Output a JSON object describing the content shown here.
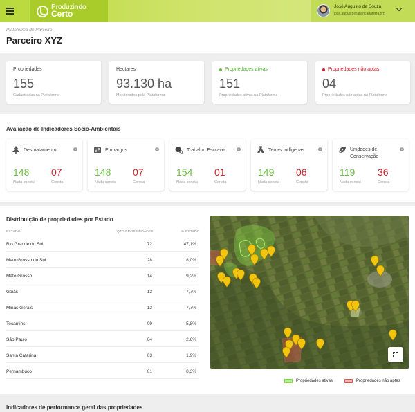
{
  "app": {
    "logo_line1": "Produzindo",
    "logo_line2": "Certo"
  },
  "user": {
    "name": "José Augusto de Souza",
    "email": "jose.augusto@aliancadaterra.org"
  },
  "header": {
    "breadcrumb": "Plataforma do Parceiro",
    "title": "Parceiro XYZ"
  },
  "summary": [
    {
      "label": "Propriedades",
      "value": "155",
      "sub": "Cadastradas na Plataforma",
      "dot": null
    },
    {
      "label": "Hectares",
      "value": "93.130 ha",
      "sub": "Monitorados pela Plataforma",
      "dot": null
    },
    {
      "label": "Propriedades ativas",
      "value": "151",
      "sub": "Propriedades ativas na Plataforma",
      "dot": "#6bbd45"
    },
    {
      "label": "Propriedades não aptas",
      "value": "04",
      "sub": "Propriedades não aptas na Plataforma",
      "dot": "#d0202c"
    }
  ],
  "indicators": {
    "title": "Avaliação de Indicadores Sócio-Ambientais",
    "cards": [
      {
        "label": "Desmatamento",
        "icon": "tree-icon",
        "ok": "148",
        "ok_label": "Nada consta",
        "bad": "07",
        "bad_label": "Consta"
      },
      {
        "label": "Embargos",
        "icon": "embargo-icon",
        "ok": "148",
        "ok_label": "Nada consta",
        "bad": "07",
        "bad_label": "Consta"
      },
      {
        "label": "Trabalho Escravo",
        "icon": "chain-icon",
        "ok": "154",
        "ok_label": "Nada consta",
        "bad": "01",
        "bad_label": "Consta"
      },
      {
        "label": "Terras Indígenas",
        "icon": "tent-icon",
        "ok": "149",
        "ok_label": "Nada consta",
        "bad": "06",
        "bad_label": "Consta"
      },
      {
        "label": "Unidades de Conservação",
        "icon": "leaf-icon",
        "ok": "119",
        "ok_label": "Nada consta",
        "bad": "36",
        "bad_label": "Consta"
      }
    ]
  },
  "distribution": {
    "title": "Distribuição de propriedades por Estado",
    "headers": [
      "ESTADO",
      "QTD PROPRIEDADES",
      "% ESTADO"
    ],
    "rows": [
      [
        "Rio Grande do Sul",
        "72",
        "47,1%"
      ],
      [
        "Mato Grosso do Sul",
        "28",
        "18,0%"
      ],
      [
        "Mato Grosso",
        "14",
        "9,2%"
      ],
      [
        "Goiás",
        "12",
        "7,7%"
      ],
      [
        "Minas Gerais",
        "12",
        "7,7%"
      ],
      [
        "Tocantins",
        "09",
        "5,8%"
      ],
      [
        "São Paulo",
        "04",
        "2,6%"
      ],
      [
        "Santa Catarina",
        "03",
        "1,9%"
      ],
      [
        "Pernambuco",
        "01",
        "0,3%"
      ]
    ],
    "legend": [
      {
        "label": "Propriedades ativas",
        "color": "#7ddc3c"
      },
      {
        "label": "Propriedades não aptas",
        "color": "#d9534f"
      }
    ]
  },
  "performance": {
    "title": "Indicadores de performance geral das propriedades"
  }
}
